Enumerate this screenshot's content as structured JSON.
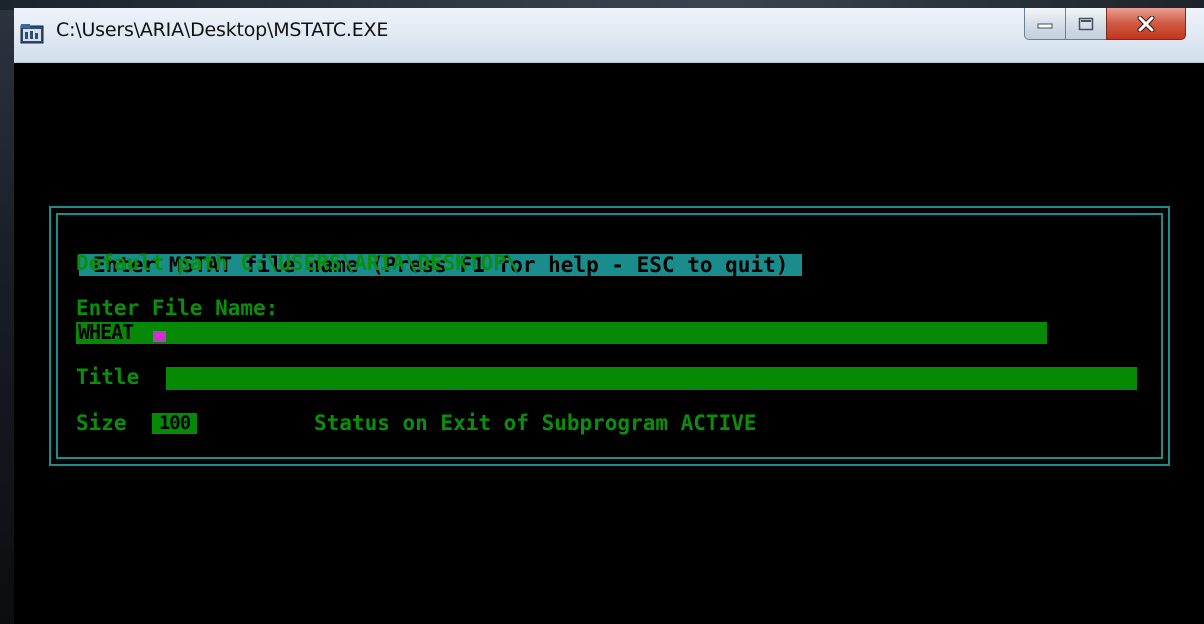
{
  "window": {
    "title": "C:\\Users\\ARIA\\Desktop\\MSTATC.EXE",
    "icon": "console-app-icon"
  },
  "dialog": {
    "title": "Enter MSTAT file name (Press F1 for help - ESC to quit)",
    "default_path": "Default path C:\\USERS\\ARIA\\DESKTOP\\",
    "file_label": "Enter File Name:",
    "file_value": "WHEAT",
    "title_label": "Title",
    "title_value": "",
    "size_label": "Size",
    "size_value": "100",
    "status": "Status on Exit of Subprogram ACTIVE"
  },
  "colors": {
    "text": "#0a8f0a",
    "field": "#068a06",
    "frame": "#1a8c8c",
    "cursor": "#cc33cc",
    "background": "#000000"
  }
}
